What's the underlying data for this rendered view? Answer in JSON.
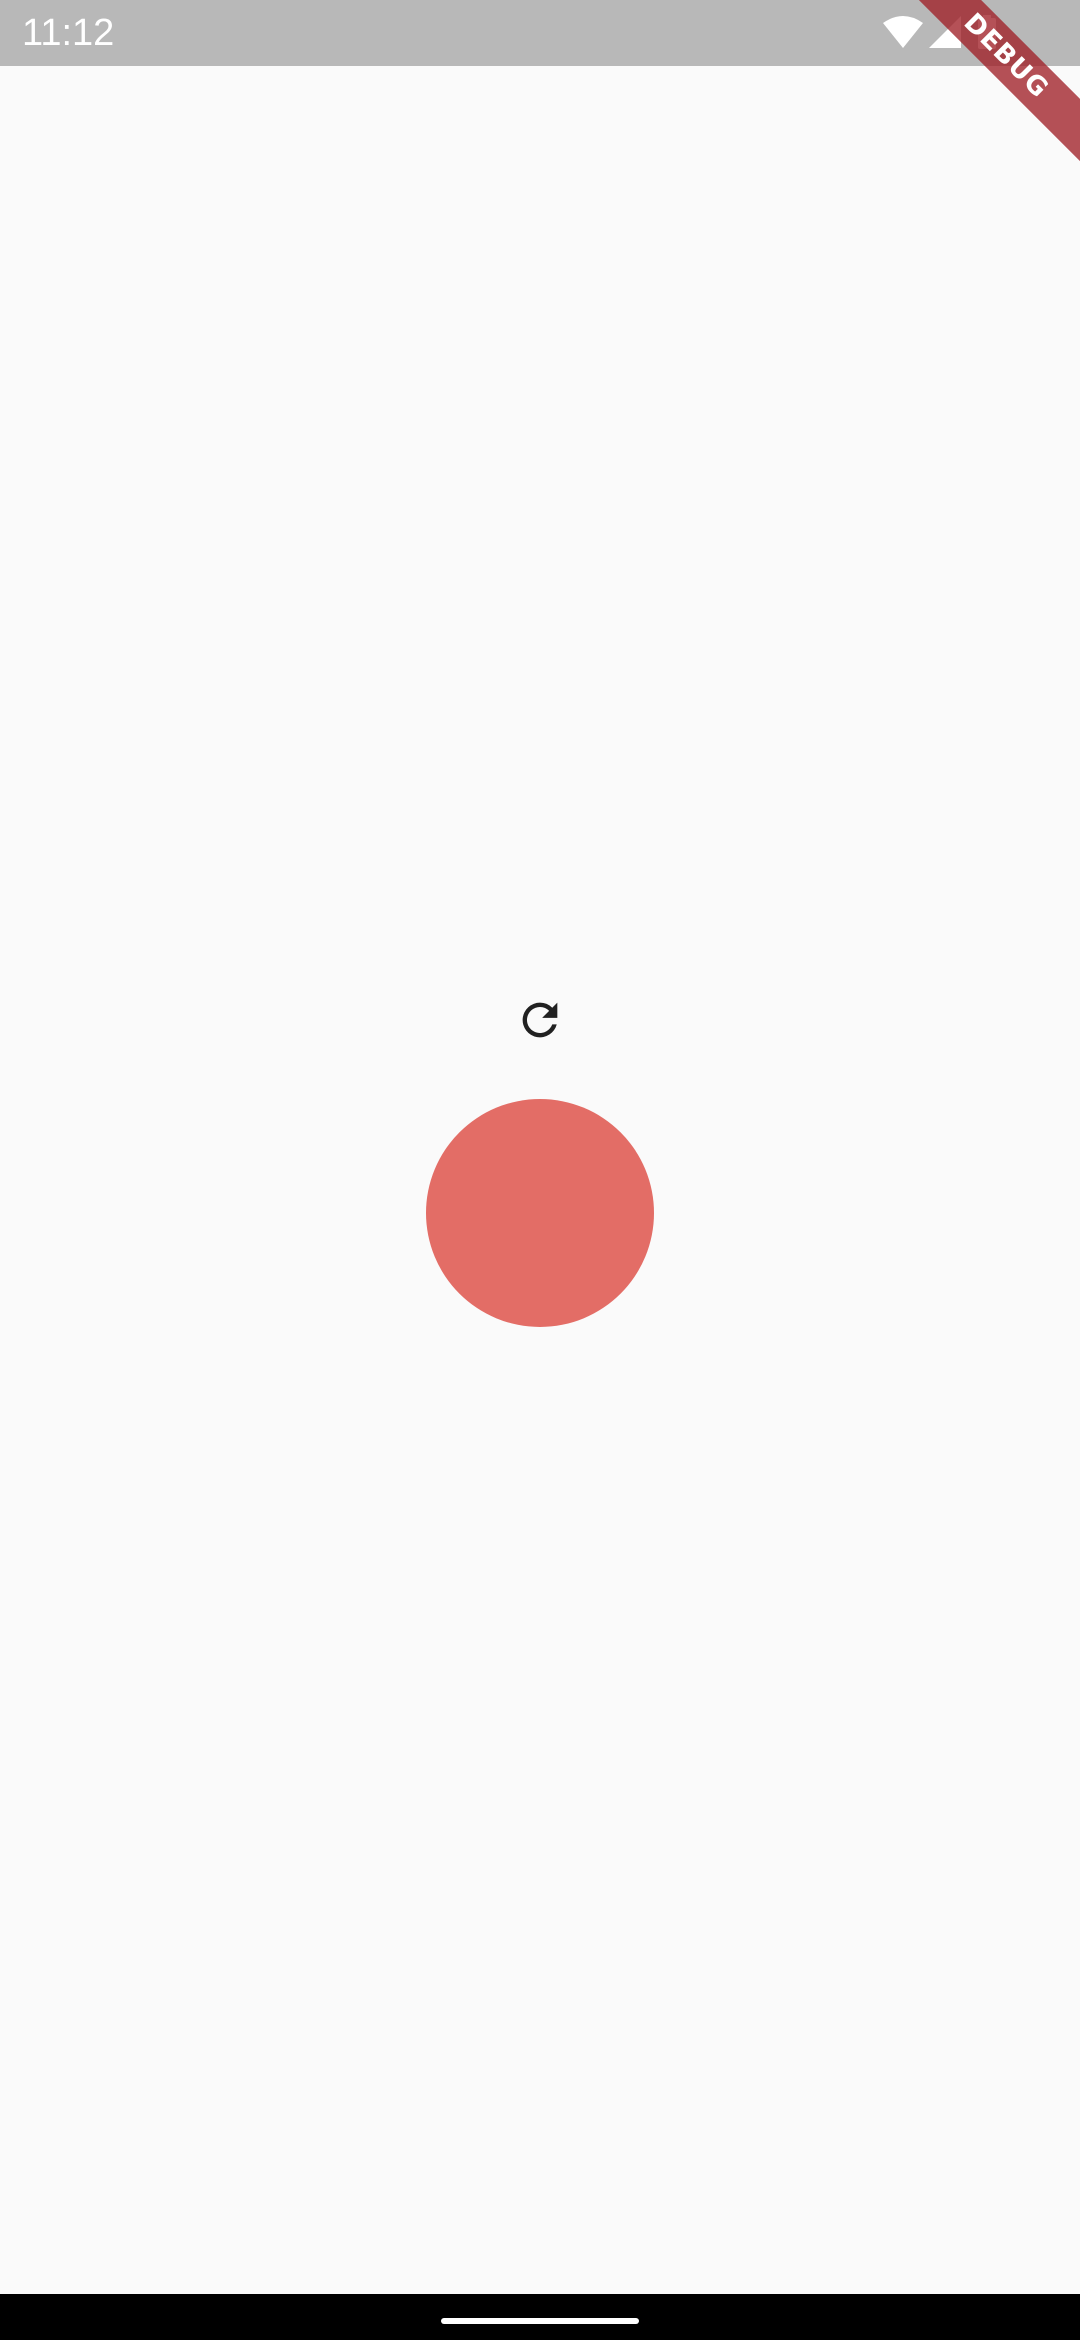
{
  "status_bar": {
    "time": "11:12",
    "icons": [
      "wifi-icon",
      "signal-icon",
      "battery-icon"
    ]
  },
  "debug_banner": {
    "label": "DEBUG"
  },
  "main": {
    "refresh_icon": "refresh-icon",
    "circle_color": "#e36d66"
  },
  "nav_bar": {
    "home_indicator": "home-indicator"
  }
}
